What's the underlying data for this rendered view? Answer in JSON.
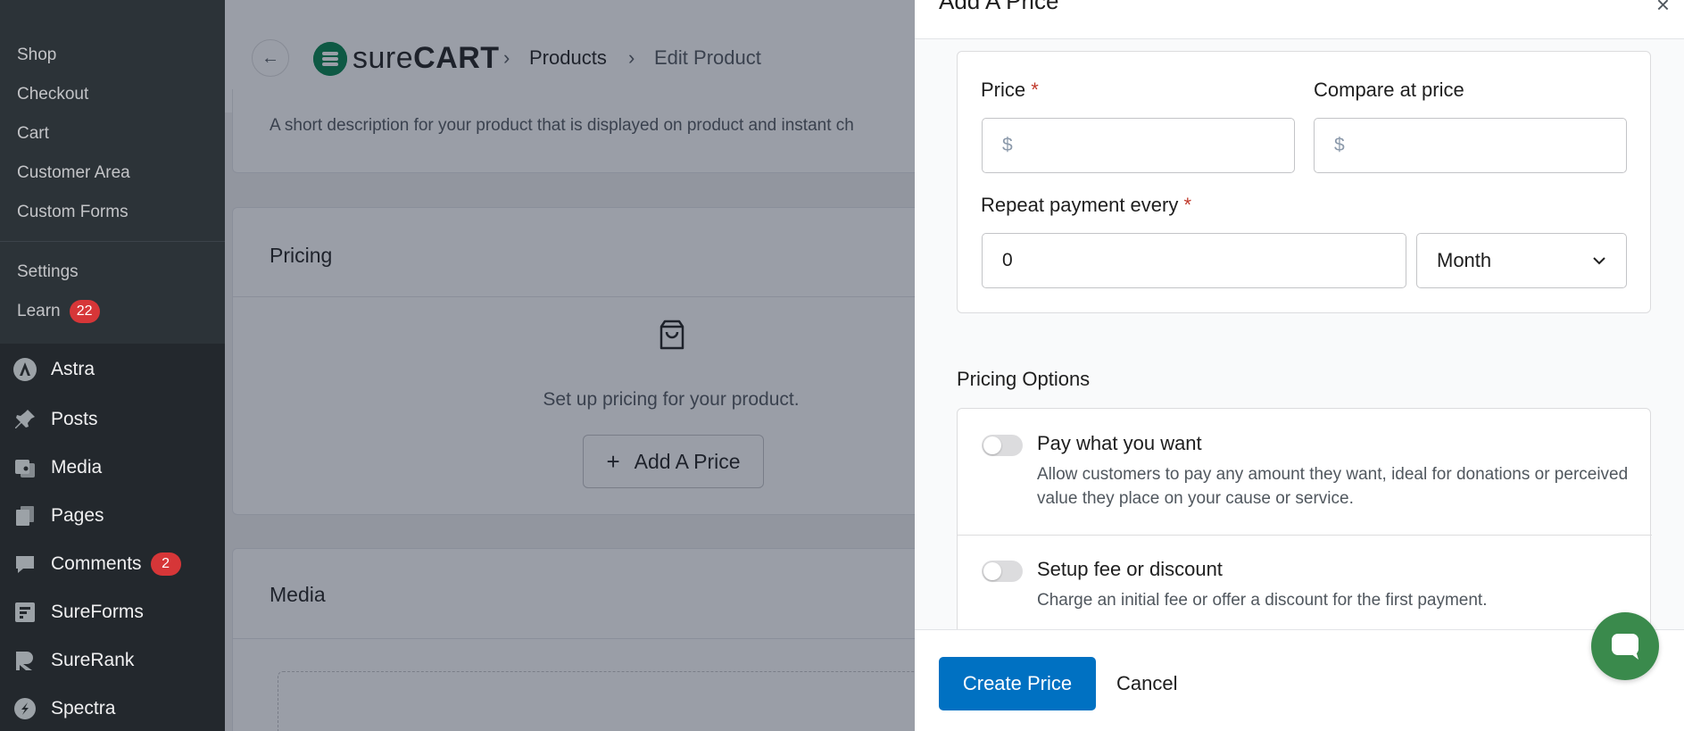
{
  "sidebar": {
    "sub_items": [
      {
        "label": "Shop"
      },
      {
        "label": "Checkout"
      },
      {
        "label": "Cart"
      },
      {
        "label": "Customer Area"
      },
      {
        "label": "Custom Forms"
      }
    ],
    "settings_label": "Settings",
    "learn_label": "Learn",
    "learn_badge": "22",
    "astra_label": "Astra",
    "menu_items": [
      {
        "label": "Posts",
        "icon": "pin-icon"
      },
      {
        "label": "Media",
        "icon": "media-icon"
      },
      {
        "label": "Pages",
        "icon": "pages-icon"
      },
      {
        "label": "Comments",
        "icon": "comments-icon",
        "badge": "2"
      },
      {
        "label": "SureForms",
        "icon": "sureforms-icon"
      },
      {
        "label": "SureRank",
        "icon": "surerank-icon"
      },
      {
        "label": "Spectra",
        "icon": "spectra-icon"
      }
    ]
  },
  "header": {
    "logo_text_light": "sure",
    "logo_text_bold": "CART",
    "crumb_products": "Products",
    "crumb_edit": "Edit Product",
    "crumb_sep": "›"
  },
  "main": {
    "description_hint": "A short description for your product that is displayed on product and instant ch",
    "pricing_title": "Pricing",
    "pricing_empty": "Set up pricing for your product.",
    "add_price_label": "Add A Price",
    "media_title": "Media"
  },
  "drawer": {
    "title": "Add A Price",
    "close": "×",
    "price_label": "Price",
    "required_mark": "*",
    "compare_label": "Compare at price",
    "currency_prefix": "$",
    "repeat_label": "Repeat payment every",
    "repeat_value": "0",
    "interval_value": "Month",
    "options_title": "Pricing Options",
    "options": [
      {
        "title": "Pay what you want",
        "desc": "Allow customers to pay any amount they want, ideal for donations or perceived value they place on your cause or service.",
        "enabled": false
      },
      {
        "title": "Setup fee or discount",
        "desc": "Charge an initial fee or offer a discount for the first payment.",
        "enabled": false
      }
    ],
    "create_label": "Create Price",
    "cancel_label": "Cancel"
  },
  "colors": {
    "primary": "#0071c2",
    "brand_green": "#01824c",
    "badge_red": "#d63638",
    "chat_green": "#3a8a4c"
  }
}
